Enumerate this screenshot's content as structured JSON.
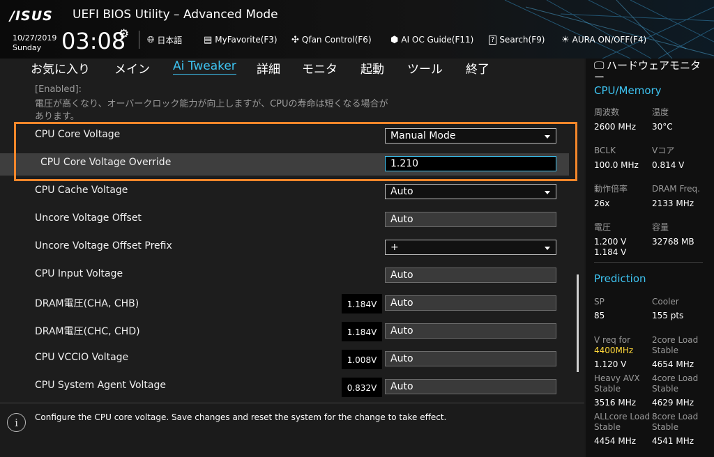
{
  "header": {
    "brand": "/ISUS",
    "app_title": "UEFI BIOS Utility – Advanced Mode",
    "date": "10/27/2019",
    "day": "Sunday",
    "time": "03:08",
    "toolbar": {
      "language": "日本語",
      "my_favorite": "MyFavorite(F3)",
      "qfan": "Qfan Control(F6)",
      "ai_oc": "AI OC Guide(F11)",
      "search": "Search(F9)",
      "aura": "AURA ON/OFF(F4)"
    }
  },
  "tabs": [
    "お気に入り",
    "メイン",
    "Ai Tweaker",
    "詳細",
    "モニタ",
    "起動",
    "ツール",
    "終了"
  ],
  "active_tab": "Ai Tweaker",
  "note": {
    "line1": "[Enabled]:",
    "line2": "電圧が高くなり、オーバークロック能力が向上しますが、CPUの寿命は短くなる場合が",
    "line3": "あります。"
  },
  "rows": {
    "cpu_core_voltage": {
      "label": "CPU Core Voltage",
      "value": "Manual Mode"
    },
    "cpu_core_voltage_override": {
      "label": "CPU Core Voltage Override",
      "value": "1.210"
    },
    "cpu_cache_voltage": {
      "label": "CPU Cache Voltage",
      "value": "Auto"
    },
    "uncore_voltage_offset": {
      "label": "Uncore Voltage Offset",
      "value": "Auto"
    },
    "uncore_voltage_offset_prefix": {
      "label": "Uncore Voltage Offset Prefix",
      "value": "+"
    },
    "cpu_input_voltage": {
      "label": "CPU Input Voltage",
      "value": "Auto"
    },
    "dram_cha_chb": {
      "label": "DRAM電圧(CHA, CHB)",
      "volt": "1.184V",
      "value": "Auto"
    },
    "dram_chc_chd": {
      "label": "DRAM電圧(CHC, CHD)",
      "volt": "1.184V",
      "value": "Auto"
    },
    "cpu_vccio": {
      "label": "CPU VCCIO Voltage",
      "volt": "1.008V",
      "value": "Auto"
    },
    "cpu_system_agent": {
      "label": "CPU System Agent Voltage",
      "volt": "0.832V",
      "value": "Auto"
    }
  },
  "help_text": "Configure the CPU core voltage. Save changes and reset the system for the change to take effect.",
  "monitor": {
    "title": "ハードウェアモニター",
    "cpu_memory": {
      "heading": "CPU/Memory",
      "freq_label": "周波数",
      "freq": "2600 MHz",
      "temp_label": "温度",
      "temp": "30°C",
      "bclk_label": "BCLK",
      "bclk": "100.0 MHz",
      "vcore_label": "Vコア",
      "vcore": "0.814 V",
      "ratio_label": "動作倍率",
      "ratio": "26x",
      "dram_freq_label": "DRAM Freq.",
      "dram_freq": "2133 MHz",
      "volt_label": "電圧",
      "volt1": "1.200 V",
      "volt2": "1.184 V",
      "capacity_label": "容量",
      "capacity": "32768 MB"
    },
    "prediction": {
      "heading": "Prediction",
      "sp_label": "SP",
      "sp": "85",
      "cooler_label": "Cooler",
      "cooler": "155 pts",
      "vreq_label": "V req for",
      "vreq_freq": "4400MHz",
      "vreq": "1.120 V",
      "load2_label1": "2core Load",
      "load2_label2": "Stable",
      "load2": "4654 MHz",
      "heavy_label1": "Heavy AVX",
      "heavy_label2": "Stable",
      "heavy": "3516 MHz",
      "load4_label1": "4core Load",
      "load4_label2": "Stable",
      "load4": "4629 MHz",
      "allcore_label1": "ALLcore Load",
      "allcore_label2": "Stable",
      "allcore": "4454 MHz",
      "load8_label1": "8core Load",
      "load8_label2": "Stable",
      "load8": "4541 MHz"
    }
  },
  "colors": {
    "accent": "#3ec4f2",
    "highlight_border": "#f2862a",
    "prediction_yellow": "#ffd83a"
  }
}
